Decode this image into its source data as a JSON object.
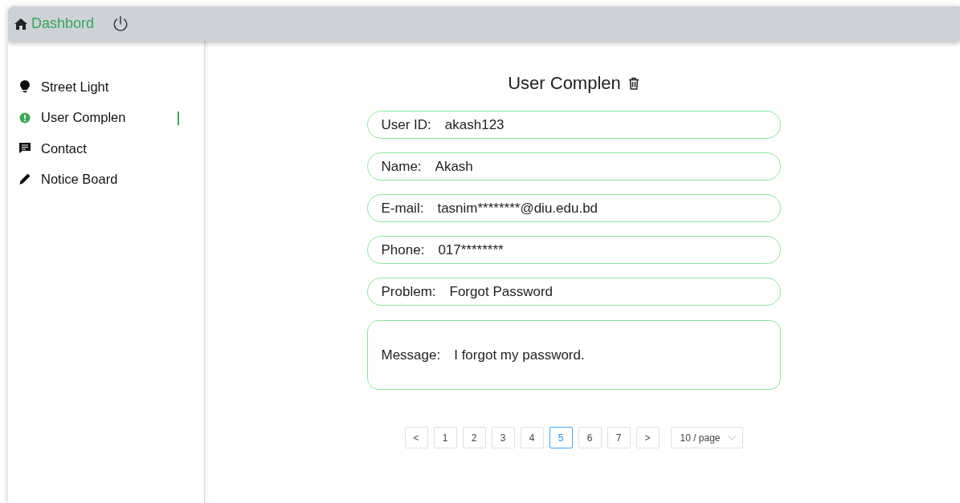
{
  "header": {
    "title": "Dashbord"
  },
  "sidebar": {
    "items": [
      {
        "label": "Street Light",
        "kind": "bulb",
        "selected": false
      },
      {
        "label": "User Complen",
        "kind": "alert",
        "selected": true
      },
      {
        "label": "Contact",
        "kind": "chat",
        "selected": false
      },
      {
        "label": "Notice Board",
        "kind": "pencil",
        "selected": false
      }
    ]
  },
  "main": {
    "title": "User Complen",
    "fields": [
      {
        "label": "User ID:",
        "value": "akash123",
        "kind": "line"
      },
      {
        "label": "Name:",
        "value": "Akash",
        "kind": "line"
      },
      {
        "label": "E-mail:",
        "value": "tasnim********@diu.edu.bd",
        "kind": "line"
      },
      {
        "label": "Phone:",
        "value": "017********",
        "kind": "line"
      },
      {
        "label": "Problem:",
        "value": "Forgot Password",
        "kind": "line"
      },
      {
        "label": "Message:",
        "value": "I forgot my password.",
        "kind": "area"
      }
    ]
  },
  "pagination": {
    "prev": "<",
    "next": ">",
    "pages": [
      {
        "label": "1",
        "selected": false
      },
      {
        "label": "2",
        "selected": false
      },
      {
        "label": "3",
        "selected": false
      },
      {
        "label": "4",
        "selected": false
      },
      {
        "label": "5",
        "selected": true
      },
      {
        "label": "6",
        "selected": false
      },
      {
        "label": "7",
        "selected": false
      }
    ],
    "page_size": "10 / page"
  }
}
